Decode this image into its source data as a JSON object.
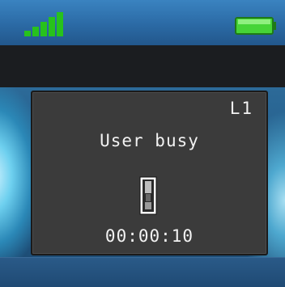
{
  "status_bar": {
    "signal_icon": "signal-strength-icon",
    "signal_color": "#27c21c",
    "battery_icon": "battery-full-icon",
    "battery_color": "#4bd63a"
  },
  "call_dialog": {
    "line": "L1",
    "status": "User busy",
    "handset_icon": "handset-icon",
    "duration": "00:00:10"
  }
}
